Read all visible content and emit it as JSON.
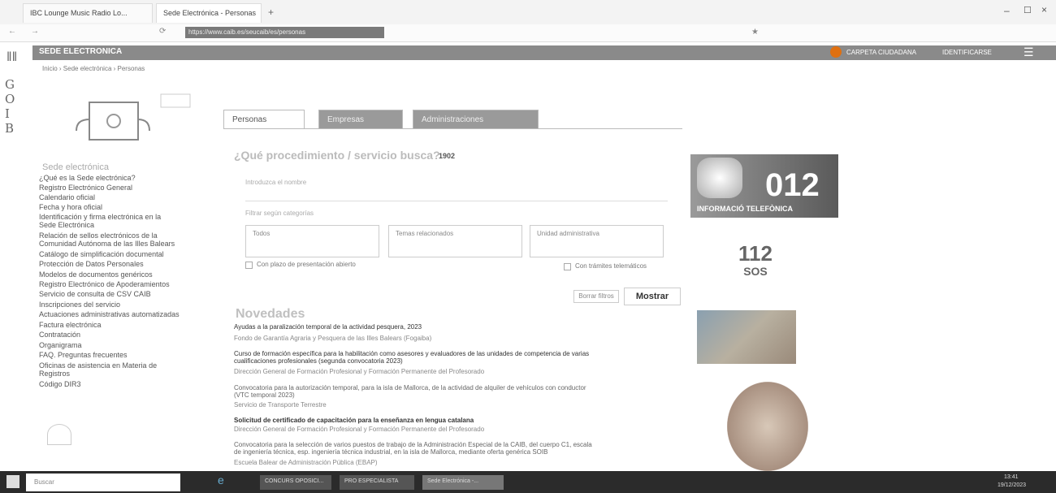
{
  "browser": {
    "tabs": [
      {
        "label": "IBC Lounge Music Radio Lo..."
      },
      {
        "label": "Sede Electrónica - Personas"
      }
    ],
    "url": "https://www.caib.es/seucaib/es/personas"
  },
  "header": {
    "site_title": "SEDE ELECTRONICA",
    "carpeta": "CARPETA CIUDADANA",
    "identificarse": "IDENTIFICARSE"
  },
  "left_rail": {
    "letters": [
      "G",
      "O",
      "I",
      "B"
    ]
  },
  "breadcrumb": {
    "items": [
      "Inicio",
      "Sede electrónica",
      "Personas"
    ]
  },
  "sidebar": {
    "menu_title": "Sede electrónica",
    "links": [
      "¿Qué es la Sede electrónica?",
      "Registro Electrónico General",
      "Calendario oficial",
      "Fecha y hora oficial",
      "Identificación y firma electrónica en la",
      "Sede Electrónica",
      "Relación de sellos electrónicos de la",
      "Comunidad Autónoma de las Illes Balears",
      "Catálogo de simplificación documental",
      "Protección de Datos Personales",
      "Modelos de documentos genéricos",
      "Registro Electrónico de Apoderamientos",
      "Servicio de consulta de CSV CAIB",
      "Inscripciones del servicio",
      "Actuaciones administrativas automatizadas",
      "Factura electrónica",
      "Contratación",
      "Organigrama",
      "FAQ. Preguntas frecuentes",
      "Oficinas de asistencia en Materia de",
      "Registros",
      "Código DIR3"
    ]
  },
  "tabs": [
    {
      "label": "Personas"
    },
    {
      "label": "Empresas"
    },
    {
      "label": "Administraciones"
    }
  ],
  "main": {
    "question": "¿Qué procedimiento / servicio busca?",
    "count": "1902",
    "search_label": "Introduzca el nombre",
    "filter_label": "Filtrar según categorías",
    "cards": [
      "Todos",
      "Temas relacionados",
      "Unidad administrativa"
    ],
    "chk_plazo": "Con plazo de presentación abierto",
    "chk_tramite": "Con trámites telemáticos",
    "borrar": "Borrar filtros",
    "mostrar": "Mostrar"
  },
  "novedades": {
    "title": "Novedades",
    "items": [
      {
        "title": "Ayudas a la paralización temporal de la actividad pesquera, 2023",
        "source": "Fondo de Garantía Agraria y Pesquera de las Illes Balears (Fogaiba)"
      },
      {
        "title": "Curso de formación específica para la habilitación como asesores y evaluadores de las unidades de competencia de varias",
        "title2": "cualificaciones profesionales (segunda convocatoria 2023)",
        "source": "Dirección General de Formación Profesional y Formación Permanente del Profesorado"
      },
      {
        "title": "Convocatoria para la autorización temporal, para la isla de Mallorca, de la actividad de alquiler de vehículos con conductor",
        "title2": "(VTC temporal 2023)",
        "source": "Servicio de Transporte Terrestre"
      },
      {
        "title": "Solicitud de certificado de capacitación para la enseñanza en lengua catalana",
        "source": "Dirección General de Formación Profesional y Formación Permanente del Profesorado"
      },
      {
        "title": "Convocatoria para la selección de varios puestos de trabajo de la Administración Especial de la CAIB, del cuerpo C1, escala",
        "title2": "de ingeniería técnica, esp. ingeniería técnica industrial, en la isla de Mallorca, mediante oferta genérica SOIB",
        "source": "Escuela Balear de Administración Pública (EBAP)"
      }
    ]
  },
  "banners": {
    "b012_big": "012",
    "b012_small": "INFORMACIÓ TELEFÒNICA",
    "b112_num": "112",
    "b112_sos": "SOS"
  },
  "taskbar": {
    "search": "Buscar",
    "items": [
      "CONCURS OPOSICI...",
      "PRO ESPECIALISTA",
      "Sede Electrónica -..."
    ],
    "time": "13:41",
    "date": "19/12/2023"
  }
}
